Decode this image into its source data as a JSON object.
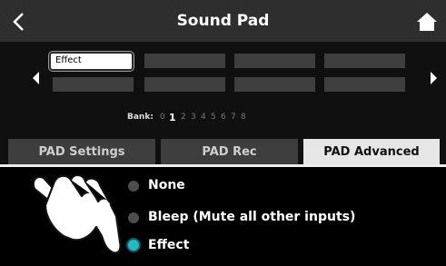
{
  "header": {
    "title": "Sound Pad",
    "back_icon": "chevron-left-icon",
    "home_icon": "home-icon"
  },
  "pads": {
    "selected_label": "Effect",
    "left_arrow_icon": "triangle-left-icon",
    "right_arrow_icon": "triangle-right-icon"
  },
  "bank": {
    "label": "Bank:",
    "numbers": [
      "0",
      "1",
      "2",
      "3",
      "4",
      "5",
      "6",
      "7",
      "8"
    ],
    "active": "1"
  },
  "tabs": [
    {
      "label": "PAD Settings",
      "active": false
    },
    {
      "label": "PAD Rec",
      "active": false
    },
    {
      "label": "PAD Advanced",
      "active": true
    }
  ],
  "options": [
    {
      "label": "None",
      "checked": false
    },
    {
      "label": "Bleep (Mute all other inputs)",
      "checked": false
    },
    {
      "label": "Effect",
      "checked": true
    }
  ],
  "colors": {
    "accent": "#23b8c2",
    "header_bg": "#2e2e2e",
    "tab_active_bg": "#e6e6e6",
    "tab_inactive_bg": "#3e3e3e"
  }
}
